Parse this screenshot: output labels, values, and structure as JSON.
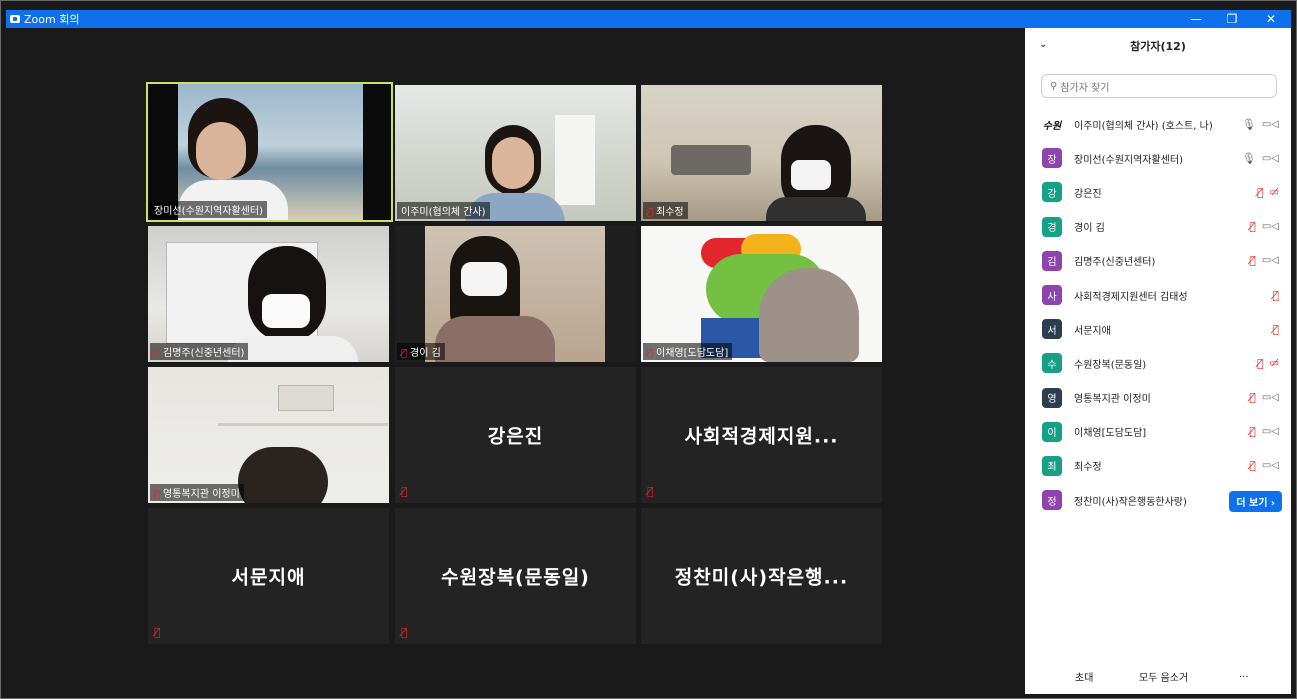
{
  "window": {
    "title": "Zoom 회의"
  },
  "tiles": [
    {
      "label": "장미선(수원지역자활센터)",
      "muted": false,
      "active": true
    },
    {
      "label": "이주미(협의체 간사)",
      "muted": false,
      "active": false
    },
    {
      "label": "최수정",
      "muted": true,
      "active": false
    },
    {
      "label": "김명주(신중년센터)",
      "muted": true,
      "active": false
    },
    {
      "label": "경이 김",
      "muted": true,
      "active": false
    },
    {
      "label": "이채영[도담도담]",
      "muted": true,
      "active": false
    },
    {
      "label": "영통복지관 이정미",
      "muted": true,
      "active": false
    },
    {
      "display_name": "강은진",
      "muted": true
    },
    {
      "display_name": "사회적경제지원...",
      "muted": true
    },
    {
      "display_name": "서문지애",
      "muted": true
    },
    {
      "display_name": "수원장복(문동일)",
      "muted": true
    },
    {
      "display_name": "정찬미(사)작은행...",
      "muted": false
    }
  ],
  "panel": {
    "title": "참가자(12)",
    "search_placeholder": "참가자 찾기",
    "participants": [
      {
        "avatar": "수원",
        "name": "이주미(협의체 간사) (호스트, 나)",
        "color": "logo",
        "mic": "on",
        "cam": "on"
      },
      {
        "avatar": "장",
        "name": "장미선(수원지역자활센터)",
        "color": "#8e44ad",
        "mic": "on",
        "cam": "on"
      },
      {
        "avatar": "강",
        "name": "강은진",
        "color": "#16a085",
        "mic": "off",
        "cam": "off"
      },
      {
        "avatar": "경",
        "name": "경이 김",
        "color": "#16a085",
        "mic": "off",
        "cam": "on"
      },
      {
        "avatar": "김",
        "name": "김명주(신중년센터)",
        "color": "#8e44ad",
        "mic": "off",
        "cam": "on"
      },
      {
        "avatar": "사",
        "name": "사회적경제지원센터 김태성",
        "color": "#8e44ad",
        "mic": "off",
        "cam": "none"
      },
      {
        "avatar": "서",
        "name": "서문지애",
        "color": "#2c3e50",
        "mic": "off",
        "cam": "none"
      },
      {
        "avatar": "수",
        "name": "수원장복(문동일)",
        "color": "#16a085",
        "mic": "off",
        "cam": "off"
      },
      {
        "avatar": "영",
        "name": "영통복지관 이정미",
        "color": "#2c3e50",
        "mic": "off",
        "cam": "on"
      },
      {
        "avatar": "이",
        "name": "이채영[도담도담]",
        "color": "#16a085",
        "mic": "off",
        "cam": "on"
      },
      {
        "avatar": "최",
        "name": "최수정",
        "color": "#16a085",
        "mic": "off",
        "cam": "on"
      },
      {
        "avatar": "정",
        "name": "정찬미(사)작은행동한사랑)",
        "color": "#8e44ad",
        "mic": "none",
        "cam": "none",
        "more": "더 보기 ›"
      }
    ],
    "footer": {
      "invite": "초대",
      "mute_all": "모두 음소거",
      "more": "..."
    }
  },
  "colors": {
    "accent": "#0e71eb",
    "active_speaker": "#c9e265",
    "muted": "#e02828"
  }
}
